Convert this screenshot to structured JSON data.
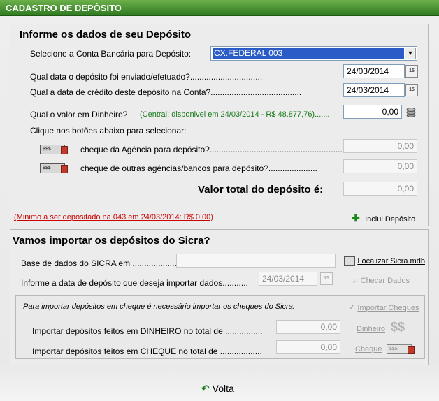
{
  "window": {
    "title": "CADASTRO DE DEPÓSITO"
  },
  "deposit": {
    "heading": "Informe os dados de seu Depósito",
    "account_label": "Selecione a Conta Bancária para Depósito:",
    "account_value": "CX.FEDERAL 003",
    "sent_date_label": "Qual data o depósito foi enviado/efetuado?...............................",
    "sent_date": "24/03/2014",
    "credit_date_label": "Qual a data de crédito deste depósito na Conta?.......................................",
    "credit_date": "24/03/2014",
    "cash_label": "Qual o valor em Dinheiro?",
    "cash_info": "(Central: disponivel em 24/03/2014 - R$ 48.877,76).......",
    "cash_value": "0,00",
    "checks_hint": "Clique nos botões abaixo para selecionar:",
    "agency_check_label": "cheque da Agência para depósito?.........................................................",
    "agency_check_value": "0,00",
    "other_check_label": "cheque de outras agências/bancos para depósito?.....................",
    "other_check_value": "0,00",
    "total_label": "Valor total do depósito é:",
    "total_value": "0,00",
    "minimum_notice": "(Minimo a ser depositado na 043 em  24/03/2014: R$ 0,00)",
    "add_button": "Inclui Depósito"
  },
  "sicra": {
    "heading": "Vamos importar os depósitos do Sicra?",
    "db_label": "Base de dados do SICRA em .....................",
    "db_value": "",
    "locate_button": "Localizar Sicra.mdb",
    "date_label": "Informe a data de depósito que deseja importar dados...........",
    "date_value": "24/03/2014",
    "check_button": "Checar Dados",
    "import_note": "Para importar depósitos em cheque é necessário importar os cheques do Sicra.",
    "import_checks_button": "Importar Cheques",
    "cash_import_label": "Importar depósitos feitos em DINHEIRO no total de ................",
    "cash_import_value": "0,00",
    "cash_button": "Dinheiro",
    "check_import_label": "Importar depósitos feitos em CHEQUE no total de ..................",
    "check_import_value": "0,00",
    "check_button_label": "Cheque"
  },
  "footer": {
    "back_label": "Volta"
  },
  "icons": {
    "calendar": "calendar-icon",
    "coins": "coins-icon",
    "check": "check-icon",
    "plus": "plus-icon",
    "database": "database-icon",
    "magnifier": "magnifier-icon",
    "checkmark": "checkmark-icon",
    "dollar": "dollar-icon",
    "back": "back-arrow-icon"
  },
  "colors": {
    "title_green": "#3d8a2c",
    "info_green": "#1a7a1a",
    "warning_red": "#cc0000",
    "select_blue": "#2a5bc6"
  }
}
